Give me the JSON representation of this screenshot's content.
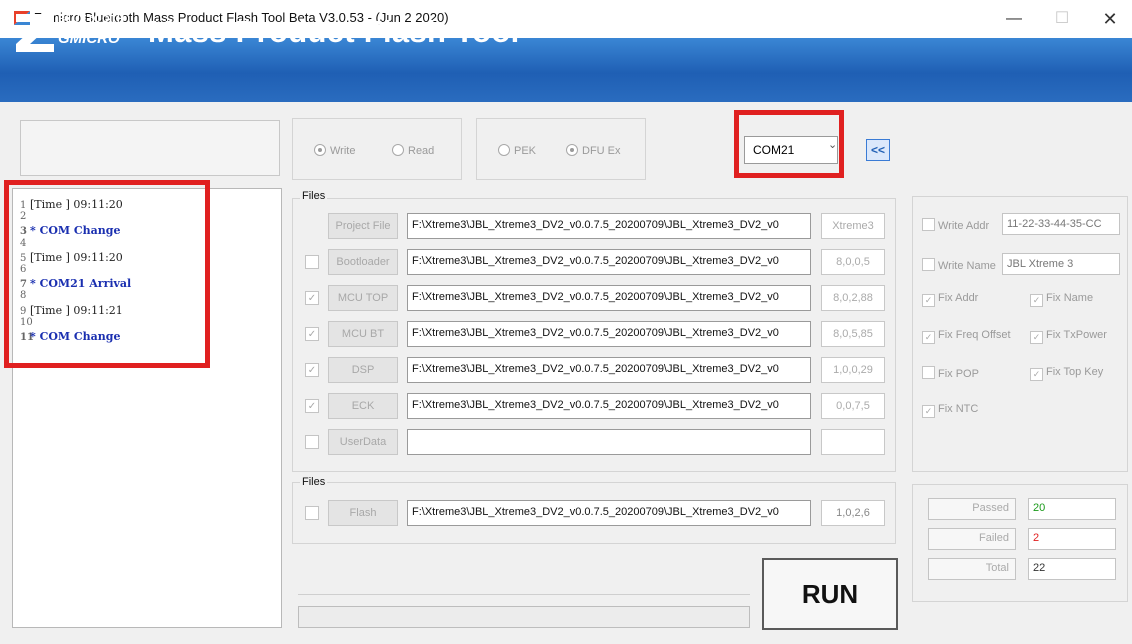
{
  "window": {
    "title": "Zgmicro Bluetooth Mass Product Flash Tool Beta V3.0.53 - (Jun  2 2020)",
    "minimize": "—",
    "maximize": "☐",
    "close": "✕"
  },
  "banner": {
    "logo_line1": "BLUETOOTH",
    "logo_line2": "GMICRO",
    "title": "Mass Product Flash Tool",
    "color": "#1f5fb4"
  },
  "log": [
    {
      "n": "1",
      "text": "[Time  ] 09:11:20",
      "style": "time"
    },
    {
      "n": "2",
      "text": "",
      "style": "blank"
    },
    {
      "n": "3",
      "text": "* COM Change",
      "style": "event"
    },
    {
      "n": "4",
      "text": "",
      "style": "blank"
    },
    {
      "n": "5",
      "text": "[Time  ] 09:11:20",
      "style": "time"
    },
    {
      "n": "6",
      "text": "",
      "style": "blank"
    },
    {
      "n": "7",
      "text": "* COM21 Arrival",
      "style": "event"
    },
    {
      "n": "8",
      "text": "",
      "style": "blank"
    },
    {
      "n": "9",
      "text": "[Time  ] 09:11:21",
      "style": "time"
    },
    {
      "n": "10",
      "text": "",
      "style": "blank"
    },
    {
      "n": "11",
      "text": "* COM Change",
      "style": "event"
    }
  ],
  "mode": {
    "write": "Write",
    "read": "Read",
    "selected": "Write"
  },
  "type": {
    "pek": "PEK",
    "dfu": "DFU Ex",
    "selected": "DFU Ex"
  },
  "com": {
    "value": "COM21",
    "collapse_label": "<<"
  },
  "files": {
    "label": "Files",
    "rows": [
      {
        "button": "Project File",
        "path": "F:\\Xtreme3\\JBL_Xtreme3_DV2_v0.0.7.5_20200709\\JBL_Xtreme3_DV2_v0",
        "version": "Xtreme3",
        "has_check": false,
        "checked": false
      },
      {
        "button": "Bootloader",
        "path": "F:\\Xtreme3\\JBL_Xtreme3_DV2_v0.0.7.5_20200709\\JBL_Xtreme3_DV2_v0",
        "version": "8,0,0,5",
        "has_check": true,
        "checked": false
      },
      {
        "button": "MCU TOP",
        "path": "F:\\Xtreme3\\JBL_Xtreme3_DV2_v0.0.7.5_20200709\\JBL_Xtreme3_DV2_v0",
        "version": "8,0,2,88",
        "has_check": true,
        "checked": true
      },
      {
        "button": "MCU BT",
        "path": "F:\\Xtreme3\\JBL_Xtreme3_DV2_v0.0.7.5_20200709\\JBL_Xtreme3_DV2_v0",
        "version": "8,0,5,85",
        "has_check": true,
        "checked": true
      },
      {
        "button": "DSP",
        "path": "F:\\Xtreme3\\JBL_Xtreme3_DV2_v0.0.7.5_20200709\\JBL_Xtreme3_DV2_v0",
        "version": "1,0,0,29",
        "has_check": true,
        "checked": true
      },
      {
        "button": "ECK",
        "path": "F:\\Xtreme3\\JBL_Xtreme3_DV2_v0.0.7.5_20200709\\JBL_Xtreme3_DV2_v0",
        "version": "0,0,7,5",
        "has_check": true,
        "checked": true
      },
      {
        "button": "UserData",
        "path": "",
        "version": "",
        "has_check": true,
        "checked": false
      }
    ]
  },
  "flash": {
    "label": "Files",
    "button": "Flash",
    "path": "F:\\Xtreme3\\JBL_Xtreme3_DV2_v0.0.7.5_20200709\\JBL_Xtreme3_DV2_v0",
    "version": "1,0,2,6",
    "checked": false
  },
  "options": {
    "write_addr_label": "Write Addr",
    "write_addr_value": "11-22-33-44-35-CC",
    "write_name_label": "Write Name",
    "write_name_value": "JBL Xtreme 3",
    "fix_addr": "Fix Addr",
    "fix_name": "Fix Name",
    "fix_freq_offset": "Fix Freq Offset",
    "fix_txpower": "Fix TxPower",
    "fix_pop": "Fix POP",
    "fix_top_key": "Fix Top Key",
    "fix_ntc": "Fix NTC",
    "check_mark": "✓"
  },
  "stats": {
    "passed_label": "Passed",
    "passed_value": "20",
    "failed_label": "Failed",
    "failed_value": "2",
    "total_label": "Total",
    "total_value": "22",
    "passed_color": "#1a9a1a",
    "failed_color": "#e02020"
  },
  "run_label": "RUN",
  "highlight_color": "#e02020"
}
